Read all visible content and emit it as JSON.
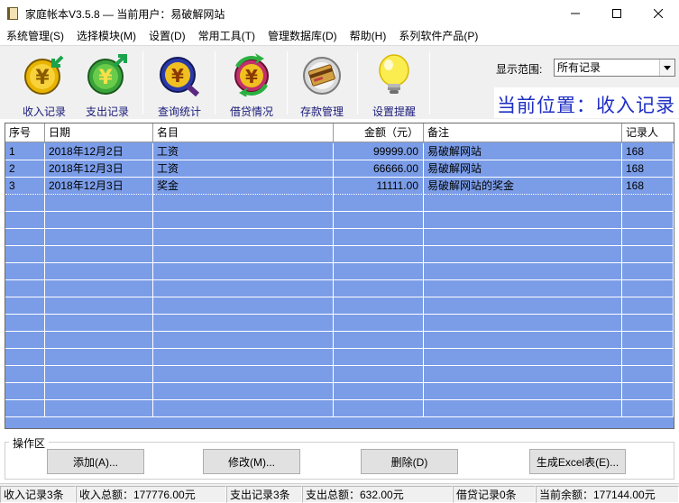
{
  "window": {
    "title": "家庭帐本V3.5.8 — 当前用户：易破解网站"
  },
  "menu": [
    "系统管理(S)",
    "选择模块(M)",
    "设置(D)",
    "常用工具(T)",
    "管理数据库(D)",
    "帮助(H)",
    "系列软件产品(P)"
  ],
  "toolbar": {
    "income": "收入记录",
    "expense": "支出记录",
    "query": "查询统计",
    "loan": "借贷情况",
    "deposit": "存款管理",
    "reminder": "设置提醒",
    "range_label": "显示范围:",
    "range_value": "所有记录",
    "location": "当前位置：收入记录"
  },
  "grid": {
    "headers": [
      "序号",
      "日期",
      "名目",
      "金额（元）",
      "备注",
      "记录人"
    ],
    "rows": [
      [
        "1",
        "2018年12月2日",
        "工资",
        "99999.00",
        "易破解网站",
        "168"
      ],
      [
        "2",
        "2018年12月3日",
        "工资",
        "66666.00",
        "易破解网站",
        "168"
      ],
      [
        "3",
        "2018年12月3日",
        "奖金",
        "11111.00",
        "易破解网站的奖金",
        "168"
      ]
    ]
  },
  "operations": {
    "title": "操作区",
    "add": "添加(A)...",
    "edit": "修改(M)...",
    "delete": "删除(D)",
    "excel": "生成Excel表(E)..."
  },
  "status": {
    "income_count": "收入记录3条",
    "income_total": "收入总额：177776.00元",
    "expense_count": "支出记录3条",
    "expense_total": "支出总额：632.00元",
    "loan_count": "借贷记录0条",
    "balance": "当前余额：177144.00元"
  },
  "colors": {
    "grid_bg": "#7b9de8",
    "location_text": "#1f2fc4",
    "label_text": "#1a1a7a"
  }
}
